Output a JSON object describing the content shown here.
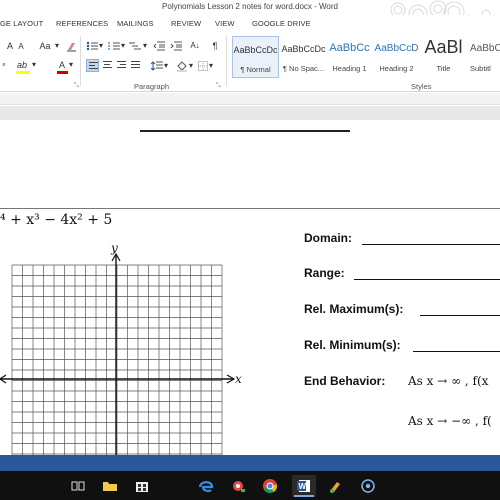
{
  "window": {
    "title": "Polynomials Lesson 2 notes for word.docx - Word"
  },
  "ribbon_tabs": [
    "GE LAYOUT",
    "REFERENCES",
    "MAILINGS",
    "REVIEW",
    "VIEW",
    "GOOGLE DRIVE"
  ],
  "font_controls": {
    "grow_font": "A",
    "shrink_font": "A",
    "change_case": "Aa",
    "format_painter_hint": "‹",
    "highlight": "ab",
    "font_color": "A"
  },
  "paragraph": {
    "group_label": "Paragraph",
    "pilcrow": "¶",
    "sort": "A↓"
  },
  "styles": {
    "group_label": "Styles",
    "items": [
      {
        "sample": "AaBbCcDc",
        "name": "¶ Normal",
        "selected": true
      },
      {
        "sample": "AaBbCcDc",
        "name": "¶ No Spac..."
      },
      {
        "sample": "AaBbCc",
        "name": "Heading 1"
      },
      {
        "sample": "AaBbCcD",
        "name": "Heading 2"
      },
      {
        "sample": "AaBl",
        "name": "Title"
      },
      {
        "sample": "AaBbC",
        "name": "Subtitl"
      }
    ]
  },
  "document": {
    "equation": "⁴ + x³ − 4x² + 5",
    "graph": {
      "y_axis_label": "y",
      "x_axis_label": "x"
    },
    "fields": {
      "domain": "Domain:",
      "range": "Range:",
      "rel_max": "Rel. Maximum(s):",
      "rel_min": "Rel. Minimum(s):",
      "end_behavior": "End Behavior:"
    },
    "end_behavior_lines": [
      "As  x → ∞ ,  f(x",
      "As  x → −∞ ,  f("
    ]
  },
  "colors": {
    "accent_blue": "#2b579a",
    "taskbar": "#101010",
    "highlight_yellow": "#ffff00",
    "font_red": "#d00000"
  }
}
